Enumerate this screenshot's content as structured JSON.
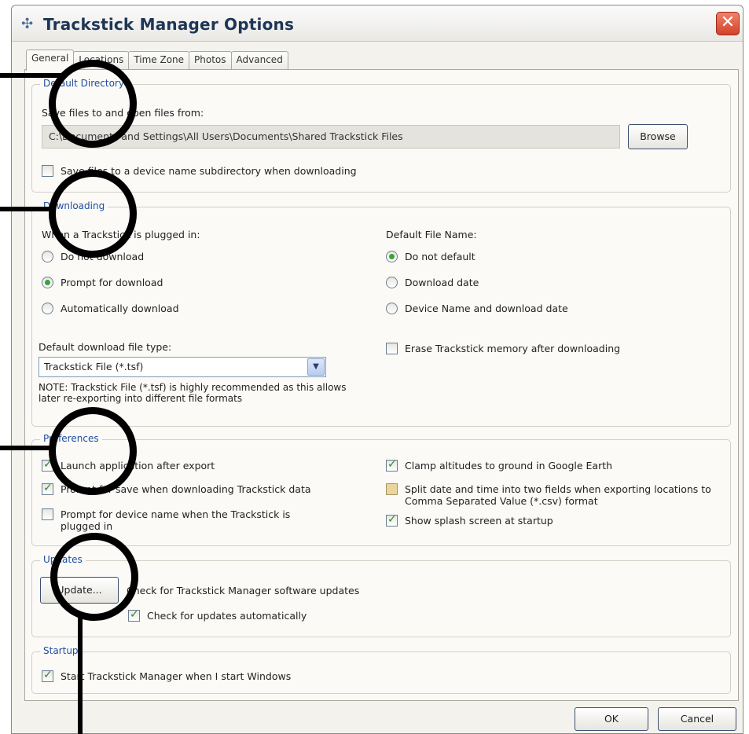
{
  "window": {
    "title": "Trackstick Manager Options",
    "close_glyph": "✕"
  },
  "tabs": [
    "General",
    "Locations",
    "Time Zone",
    "Photos",
    "Advanced"
  ],
  "default_directory": {
    "legend": "Default Directory",
    "save_label": "Save files to and open files from:",
    "path": "C:\\Documents and Settings\\All Users\\Documents\\Shared Trackstick Files",
    "browse_label": "Browse",
    "subdir_label": "Save files to a device name subdirectory when downloading"
  },
  "downloading": {
    "legend": "Downloading",
    "plugged_label": "When a Trackstick is plugged in:",
    "options": [
      "Do not download",
      "Prompt for download",
      "Automatically download"
    ],
    "filename_label": "Default File Name:",
    "filename_options": [
      "Do not default",
      "Download date",
      "Device Name and download date"
    ],
    "filetype_label": "Default download file type:",
    "filetype_value": "Trackstick File (*.tsf)",
    "note": "NOTE: Trackstick File (*.tsf) is highly recommended as this allows later re-exporting into different file formats",
    "erase_label": "Erase Trackstick memory after downloading"
  },
  "preferences": {
    "legend": "Preferences",
    "launch_label": "Launch application after export",
    "prompt_save_label": "Prompt for save when downloading Trackstick data",
    "prompt_device_label": "Prompt for device name when the Trackstick is plugged in",
    "clamp_label": "Clamp altitudes to ground in Google Earth",
    "split_label": "Split date and time into two fields when exporting locations to Comma Separated Value (*.csv) format",
    "splash_label": "Show splash screen at startup"
  },
  "updates": {
    "legend": "Updates",
    "update_button": "Update...",
    "check_label": "Check for Trackstick Manager software updates",
    "auto_label": "Check for updates automatically"
  },
  "startup": {
    "legend": "Startup",
    "start_label": "Start Trackstick Manager when I start Windows"
  },
  "buttons": {
    "ok": "OK",
    "cancel": "Cancel"
  }
}
